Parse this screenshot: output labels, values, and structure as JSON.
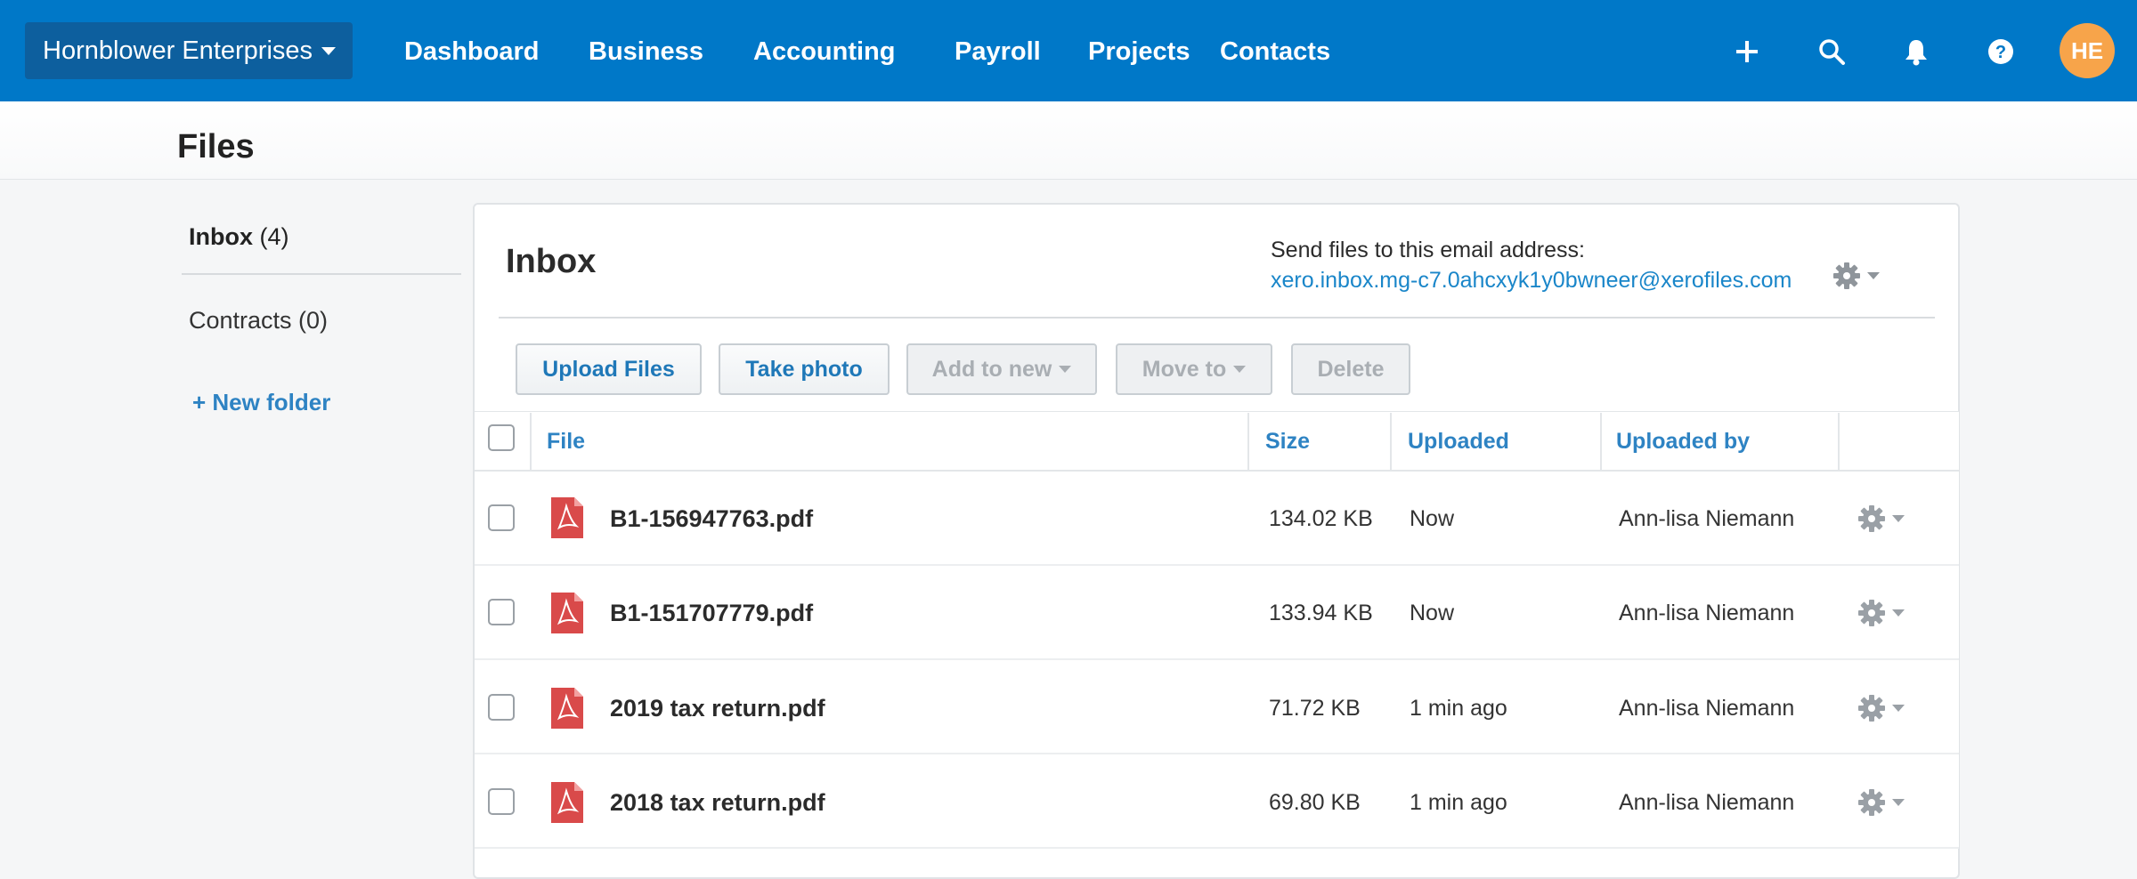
{
  "topnav": {
    "org_name": "Hornblower Enterprises",
    "links": [
      "Dashboard",
      "Business",
      "Accounting",
      "Payroll",
      "Projects",
      "Contacts"
    ],
    "icons": [
      "plus-icon",
      "search-icon",
      "bell-icon",
      "help-icon"
    ],
    "avatar_initials": "HE",
    "colors": {
      "bar": "#0078c8",
      "avatar": "#f7a44a"
    }
  },
  "page": {
    "title": "Files"
  },
  "sidebar": {
    "inbox_label": "Inbox",
    "inbox_count": "(4)",
    "contracts_label": "Contracts (0)",
    "new_folder_label": "+ New folder"
  },
  "panel": {
    "title": "Inbox",
    "email_label": "Send files to this email address:",
    "email_address": "xero.inbox.mg-c7.0ahcxyk1y0bwneer@xerofiles.com"
  },
  "toolbar": {
    "upload_label": "Upload Files",
    "photo_label": "Take photo",
    "add_new_label": "Add to new",
    "move_to_label": "Move to",
    "delete_label": "Delete"
  },
  "table": {
    "headers": {
      "file": "File",
      "size": "Size",
      "uploaded": "Uploaded",
      "uploaded_by": "Uploaded by"
    },
    "rows": [
      {
        "file": "B1-156947763.pdf",
        "size": "134.02 KB",
        "uploaded": "Now",
        "uploaded_by": "Ann-lisa Niemann"
      },
      {
        "file": "B1-151707779.pdf",
        "size": "133.94 KB",
        "uploaded": "Now",
        "uploaded_by": "Ann-lisa Niemann"
      },
      {
        "file": "2019 tax return.pdf",
        "size": "71.72 KB",
        "uploaded": "1 min ago",
        "uploaded_by": "Ann-lisa Niemann"
      },
      {
        "file": "2018 tax return.pdf",
        "size": "69.80 KB",
        "uploaded": "1 min ago",
        "uploaded_by": "Ann-lisa Niemann"
      }
    ]
  }
}
